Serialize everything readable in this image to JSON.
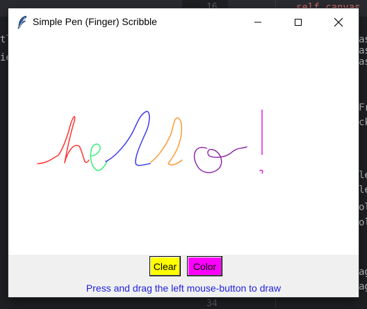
{
  "window": {
    "title": "Simple Pen (Finger) Scribble",
    "icon": "feather-icon",
    "controls": [
      "minimize-icon",
      "maximize-icon",
      "close-icon"
    ]
  },
  "toolbar": {
    "clear_label": "Clear",
    "clear_color": "#ffff00",
    "color_label": "Color",
    "color_color": "#ff00ff"
  },
  "hint": "Press and drag the left mouse-button to draw",
  "scribble_colors": {
    "h": "#ff3333",
    "e": "#33ee77",
    "l1": "#3a3aee",
    "l2": "#ff9933",
    "o": "#8e2aa8",
    "exclaim": "#e01ee0"
  },
  "background": {
    "line_numbers": [
      "16",
      "34"
    ],
    "code_fragments": [
      "self.canvas",
      "as",
      "as",
      "as",
      "Fr",
      "ck",
      "le",
      "le",
      "ol",
      "ol",
      "ag",
      "ag",
      "ie",
      "tl"
    ]
  }
}
